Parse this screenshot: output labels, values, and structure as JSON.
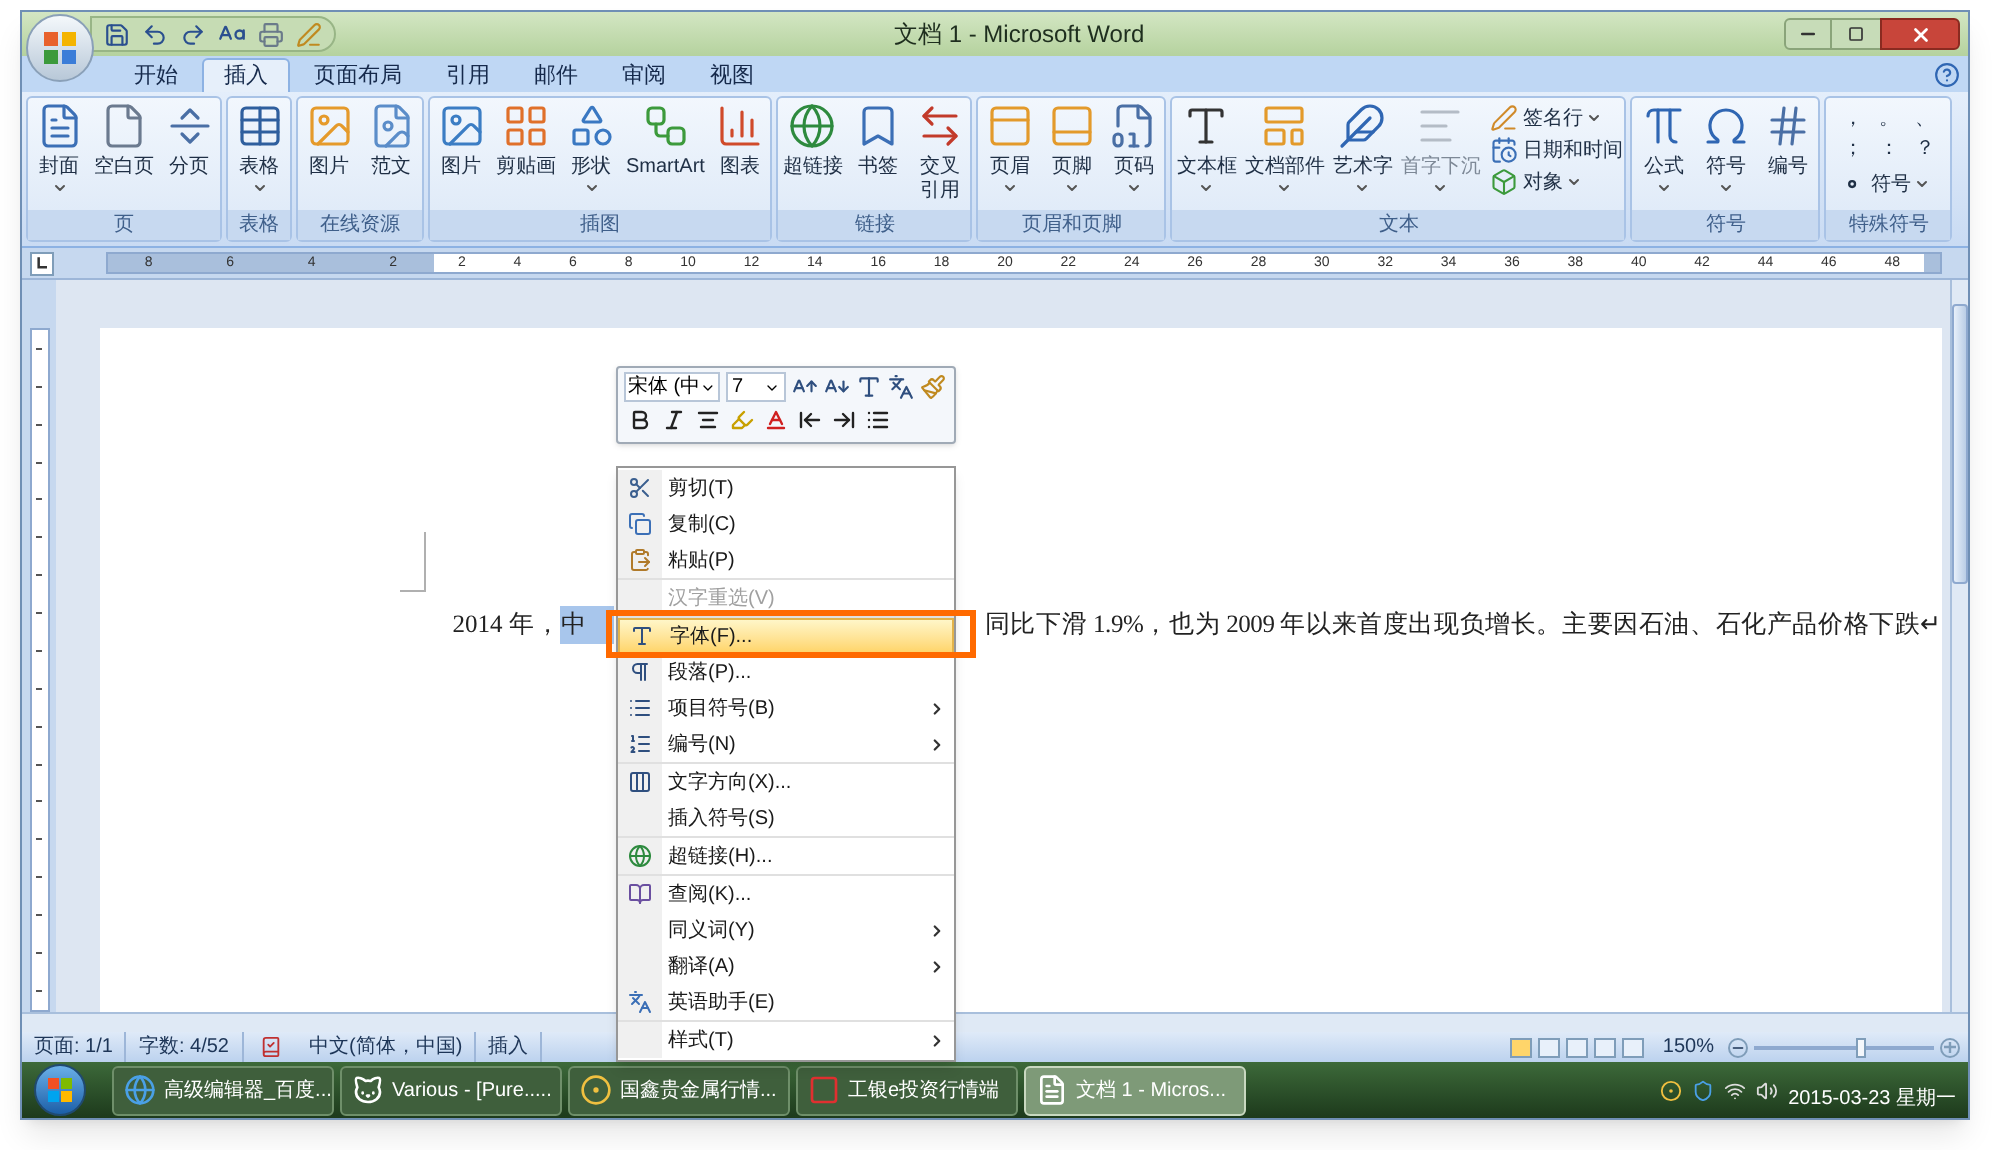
{
  "window": {
    "title": "文档 1 - Microsoft Word"
  },
  "tabs": [
    {
      "label": "开始",
      "selected": false
    },
    {
      "label": "插入",
      "selected": true
    },
    {
      "label": "页面布局",
      "selected": false
    },
    {
      "label": "引用",
      "selected": false
    },
    {
      "label": "邮件",
      "selected": false
    },
    {
      "label": "审阅",
      "selected": false
    },
    {
      "label": "视图",
      "selected": false
    }
  ],
  "ribbon": {
    "groups": [
      {
        "label": "页",
        "buttons": [
          {
            "label": "封面",
            "dropdown": true,
            "disabled": false
          },
          {
            "label": "空白页",
            "dropdown": false,
            "disabled": false
          },
          {
            "label": "分页",
            "dropdown": false,
            "disabled": false
          }
        ]
      },
      {
        "label": "表格",
        "buttons": [
          {
            "label": "表格",
            "dropdown": true,
            "disabled": false
          }
        ]
      },
      {
        "label": "在线资源",
        "buttons": [
          {
            "label": "图片",
            "dropdown": false,
            "disabled": false
          },
          {
            "label": "范文",
            "dropdown": false,
            "disabled": false
          }
        ]
      },
      {
        "label": "插图",
        "buttons": [
          {
            "label": "图片",
            "dropdown": false,
            "disabled": false
          },
          {
            "label": "剪贴画",
            "dropdown": false,
            "disabled": false
          },
          {
            "label": "形状",
            "dropdown": true,
            "disabled": false
          },
          {
            "label": "SmartArt",
            "dropdown": false,
            "disabled": false
          },
          {
            "label": "图表",
            "dropdown": false,
            "disabled": false
          }
        ]
      },
      {
        "label": "链接",
        "buttons": [
          {
            "label": "超链接",
            "dropdown": false,
            "disabled": false
          },
          {
            "label": "书签",
            "dropdown": false,
            "disabled": false
          },
          {
            "label": "交叉引用",
            "dropdown": false,
            "disabled": false
          }
        ]
      },
      {
        "label": "页眉和页脚",
        "buttons": [
          {
            "label": "页眉",
            "dropdown": true,
            "disabled": false
          },
          {
            "label": "页脚",
            "dropdown": true,
            "disabled": false
          },
          {
            "label": "页码",
            "dropdown": true,
            "disabled": false
          }
        ]
      },
      {
        "label": "文本",
        "buttons": [
          {
            "label": "文本框",
            "dropdown": true,
            "disabled": false
          },
          {
            "label": "文档部件",
            "dropdown": true,
            "disabled": false
          },
          {
            "label": "艺术字",
            "dropdown": true,
            "disabled": false
          },
          {
            "label": "首字下沉",
            "dropdown": true,
            "disabled": true
          }
        ],
        "small_buttons": [
          {
            "label": "签名行",
            "dropdown": true
          },
          {
            "label": "日期和时间",
            "dropdown": false
          },
          {
            "label": "对象",
            "dropdown": true
          }
        ]
      },
      {
        "label": "符号",
        "buttons": [
          {
            "label": "公式",
            "dropdown": true,
            "disabled": false
          },
          {
            "label": "符号",
            "dropdown": true,
            "disabled": false
          },
          {
            "label": "编号",
            "dropdown": false,
            "disabled": false
          }
        ]
      },
      {
        "label": "特殊符号",
        "marks": [
          "，",
          "。",
          "、",
          "；",
          "：",
          "？"
        ],
        "small_buttons": [
          {
            "label": "符号",
            "dropdown": true
          }
        ]
      }
    ]
  },
  "ruler": {
    "left_ticks": [
      "8",
      "6",
      "4",
      "2"
    ],
    "right_ticks": [
      "2",
      "4",
      "6",
      "8",
      "10",
      "12",
      "14",
      "16",
      "18",
      "20",
      "22",
      "24",
      "26",
      "28",
      "30",
      "32",
      "34",
      "36",
      "38",
      "40",
      "42",
      "44",
      "46",
      "48"
    ]
  },
  "document": {
    "text_before": "2014 年，",
    "selected_text": "中",
    "text_after": "同比下滑 1.9%，也为 2009 年以来首度出现负增长。主要因石油、石化产品价格下跌↵"
  },
  "mini_toolbar": {
    "font": "宋体 (中",
    "size": "7"
  },
  "context_menu": {
    "groups": [
      [
        {
          "label": "剪切(T)",
          "kind": "item",
          "disabled": false,
          "selected": false
        },
        {
          "label": "复制(C)",
          "kind": "item",
          "disabled": false,
          "selected": false
        },
        {
          "label": "粘贴(P)",
          "kind": "item",
          "disabled": false,
          "selected": false
        }
      ],
      [
        {
          "label": "汉字重选(V)",
          "kind": "item",
          "disabled": true,
          "selected": false
        }
      ],
      [
        {
          "label": "字体(F)...",
          "kind": "item",
          "disabled": false,
          "selected": true
        },
        {
          "label": "段落(P)...",
          "kind": "item",
          "disabled": false,
          "selected": false
        },
        {
          "label": "项目符号(B)",
          "kind": "submenu",
          "disabled": false,
          "selected": false
        },
        {
          "label": "编号(N)",
          "kind": "submenu",
          "disabled": false,
          "selected": false
        }
      ],
      [
        {
          "label": "文字方向(X)...",
          "kind": "item",
          "disabled": false,
          "selected": false
        },
        {
          "label": "插入符号(S)",
          "kind": "item",
          "disabled": false,
          "selected": false
        }
      ],
      [
        {
          "label": "超链接(H)...",
          "kind": "item",
          "disabled": false,
          "selected": false
        }
      ],
      [
        {
          "label": "查阅(K)...",
          "kind": "item",
          "disabled": false,
          "selected": false
        },
        {
          "label": "同义词(Y)",
          "kind": "submenu",
          "disabled": false,
          "selected": false
        },
        {
          "label": "翻译(A)",
          "kind": "submenu",
          "disabled": false,
          "selected": false
        },
        {
          "label": "英语助手(E)",
          "kind": "item",
          "disabled": false,
          "selected": false
        }
      ],
      [
        {
          "label": "样式(T)",
          "kind": "submenu",
          "disabled": false,
          "selected": false
        }
      ]
    ]
  },
  "status_bar": {
    "items": [
      "页面: 1/1",
      "字数: 4/52",
      "中文(简体，中国)",
      "插入"
    ],
    "zoom": "150%",
    "zoom_slider": {
      "level": 0.6
    }
  },
  "taskbar": {
    "tasks": [
      {
        "label": "高级编辑器_百度...",
        "selected": false
      },
      {
        "label": "Various - [Pure.....",
        "selected": false
      },
      {
        "label": "国鑫贵金属行情...",
        "selected": false
      },
      {
        "label": "工银e投资行情端",
        "selected": false
      },
      {
        "label": "文档 1 - Micros...",
        "selected": true
      }
    ],
    "date": "2015-03-23 星期一"
  }
}
